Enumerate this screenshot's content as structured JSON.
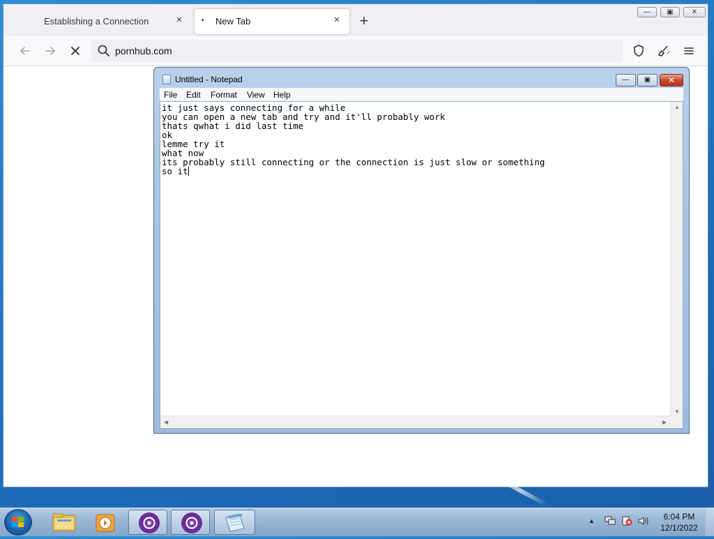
{
  "browser": {
    "tabs": [
      {
        "title": "Establishing a Connection",
        "close": "×",
        "active": false
      },
      {
        "title": "New Tab",
        "close": "×",
        "active": true,
        "indicator": "•"
      }
    ],
    "new_tab_label": "+",
    "window_controls": {
      "minimize": "—",
      "maximize": "▣",
      "close": "✕"
    },
    "nav": {
      "back_icon": "arrow-left",
      "forward_icon": "arrow-right",
      "stop_icon": "stop-x"
    },
    "url": "pornhub.com",
    "toolbar_icons": [
      "shield-icon",
      "brush-icon",
      "menu-icon"
    ]
  },
  "notepad": {
    "title": "Untitled - Notepad",
    "menu": [
      "File",
      "Edit",
      "Format",
      "View",
      "Help"
    ],
    "lines": [
      "it just says connecting for a while",
      "you can open a new tab and try and it'll probably work",
      "thats qwhat i did last time",
      "ok",
      "lemme try it",
      "what now",
      "its probably still connecting or the connection is just slow or something",
      "so it"
    ],
    "controls": {
      "minimize": "—",
      "maximize": "▣",
      "close": "✕"
    }
  },
  "taskbar": {
    "pinned": [
      "folder-icon",
      "media-player-icon",
      "tor-browser-icon",
      "tor-browser-icon",
      "notepad-icon"
    ],
    "tray_icons": [
      "▲",
      "network-icon",
      "action-center-icon",
      "volume-icon"
    ],
    "time": "6:04 PM",
    "date": "12/1/2022"
  },
  "colors": {
    "desktop": "#1d6fbd",
    "taskbar": "#9ab7d6",
    "notepad_frame": "#a8c4e3",
    "notepad_close": "#c8442d"
  }
}
